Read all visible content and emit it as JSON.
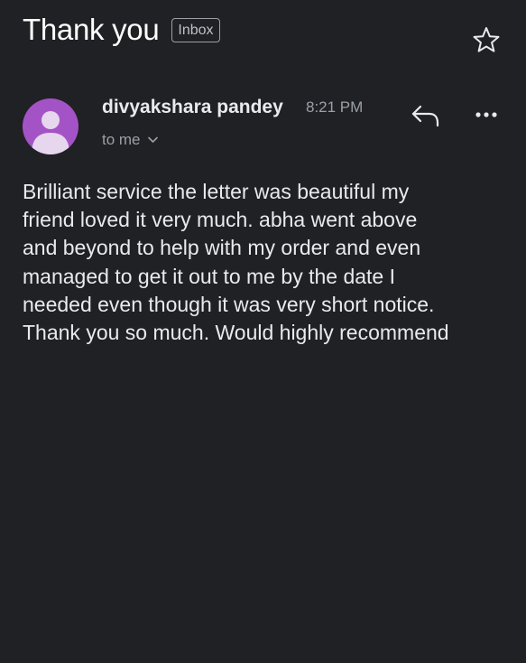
{
  "message": {
    "subject": "Thank you",
    "label": "Inbox",
    "sender": "divyakshara pandey",
    "time": "8:21 PM",
    "recipients": "to me",
    "body_lines": [
      "Brilliant service the letter was beautiful my",
      "friend loved it very much. abha went above",
      "and beyond to help with my order and even",
      "managed to get it out to me by the date I",
      "needed even though it was very short notice.",
      "Thank you so much. Would highly recommend"
    ]
  },
  "icons": {
    "star": "star-outline-icon",
    "reply": "reply-icon",
    "more": "more-horizontal-icon",
    "expand": "chevron-down-icon",
    "avatar": "person-icon"
  },
  "colors": {
    "background": "#202124",
    "avatar": "#a453c6",
    "text_primary": "#e8eaed",
    "text_secondary": "#9aa0a6"
  }
}
